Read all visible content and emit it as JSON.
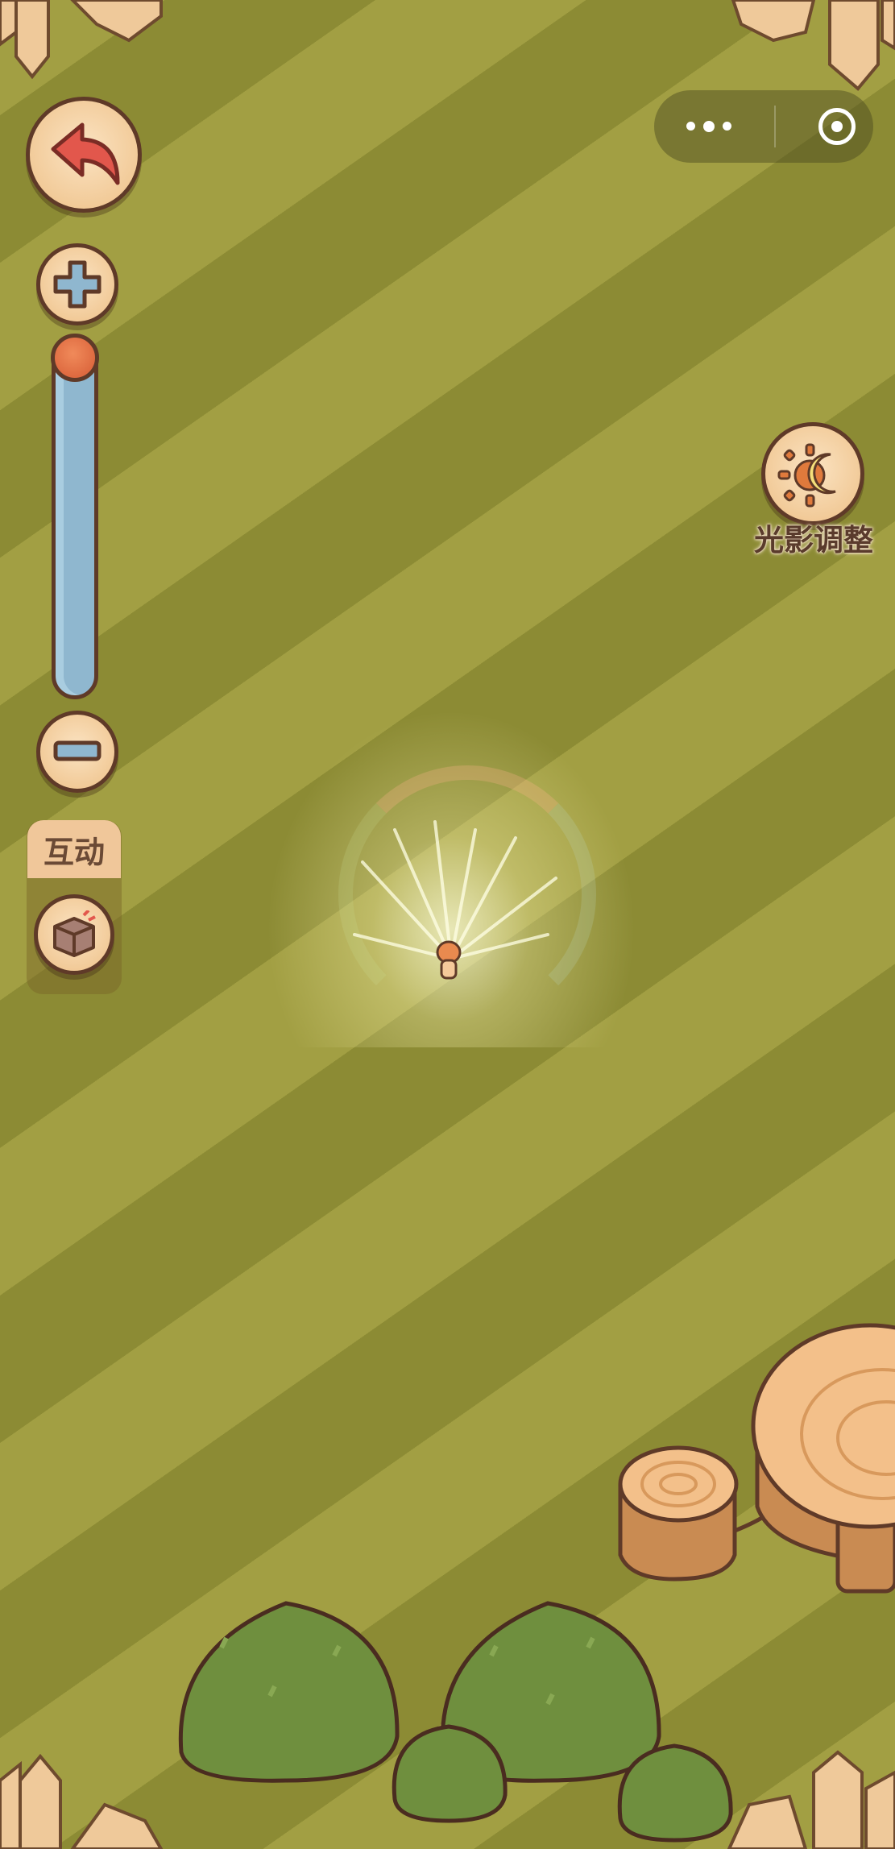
{
  "scene": {
    "grass_light": "#a29f43",
    "grass_dark": "#8c8b34"
  },
  "capsule": {
    "more_icon": "more-dots-icon",
    "close_icon": "target-circle-icon"
  },
  "controls": {
    "back_icon": "back-arrow-icon",
    "zoom_in_icon": "plus-icon",
    "zoom_out_icon": "minus-icon",
    "zoom_level": 0.0
  },
  "interact": {
    "label": "互动",
    "icon": "box-interact-icon"
  },
  "light": {
    "label": "光影调整",
    "icon": "sun-moon-icon"
  },
  "colors": {
    "button_face": "#f1c996",
    "outline": "#5f3a28",
    "accent_red": "#e2574c",
    "slider_blue": "#8fb7cf"
  }
}
